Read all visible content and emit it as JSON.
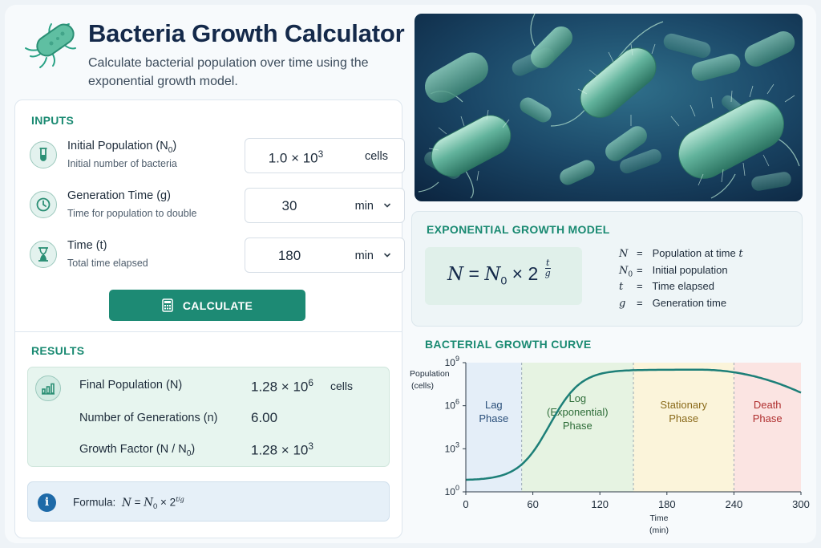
{
  "header": {
    "title": "Bacteria Growth Calculator",
    "subtitle": "Calculate bacterial population over time using the exponential growth model."
  },
  "inputs": {
    "section_title": "INPUTS",
    "initial_population": {
      "label_main": "Initial Population (N",
      "label_sub": "0",
      "label_end": ")",
      "description": "Initial number of bacteria",
      "value_mantissa": "1.0 × 10",
      "value_exp": "3",
      "unit": "cells",
      "icon": "test-tube-icon"
    },
    "generation_time": {
      "label": "Generation Time (g)",
      "description": "Time for population to double",
      "value": "30",
      "unit": "min",
      "icon": "clock-icon"
    },
    "time": {
      "label": "Time (t)",
      "description": "Total time elapsed",
      "value": "180",
      "unit": "min",
      "icon": "hourglass-icon"
    },
    "calculate_label": "CALCULATE"
  },
  "results": {
    "section_title": "RESULTS",
    "final_population": {
      "label": "Final Population (N)",
      "value_mantissa": "1.28 × 10",
      "value_exp": "6",
      "unit": "cells"
    },
    "generations": {
      "label": "Number of Generations (n)",
      "value": "6.00"
    },
    "growth_factor": {
      "label_main": "Growth Factor (N / N",
      "label_sub": "0",
      "label_end": ")",
      "value_mantissa": "1.28 × 10",
      "value_exp": "3"
    },
    "formula_label": "Formula:"
  },
  "model": {
    "section_title": "EXPONENTIAL GROWTH MODEL",
    "legend": [
      {
        "symbol": "N",
        "sub": "",
        "eq": "=",
        "text": "Population at time ",
        "var": "t"
      },
      {
        "symbol": "N",
        "sub": "0",
        "eq": "=",
        "text": "Initial population",
        "var": ""
      },
      {
        "symbol": "t",
        "sub": "",
        "eq": "=",
        "text": "Time elapsed",
        "var": ""
      },
      {
        "symbol": "g",
        "sub": "",
        "eq": "=",
        "text": "Generation time",
        "var": ""
      }
    ]
  },
  "curve": {
    "section_title": "BACTERIAL GROWTH CURVE",
    "ylabel_line1": "Population",
    "ylabel_line2": "(cells)",
    "xlabel_line1": "Time",
    "xlabel_line2": "(min)",
    "y_ticks": [
      {
        "base": "10",
        "exp": "0",
        "value": 0
      },
      {
        "base": "10",
        "exp": "3",
        "value": 3
      },
      {
        "base": "10",
        "exp": "6",
        "value": 6
      },
      {
        "base": "10",
        "exp": "9",
        "value": 9
      }
    ],
    "x_ticks": [
      "0",
      "60",
      "120",
      "180",
      "240",
      "300"
    ],
    "phases": [
      {
        "name_lines": [
          "Lag",
          "Phase"
        ],
        "start": 0,
        "end": 50,
        "fill": "#e4eef8",
        "text_color": "#2a4f7a"
      },
      {
        "name_lines": [
          "Log",
          "(Exponential)",
          "Phase"
        ],
        "start": 50,
        "end": 150,
        "fill": "#e6f3e2",
        "text_color": "#2f6e3a"
      },
      {
        "name_lines": [
          "Stationary",
          "Phase"
        ],
        "start": 150,
        "end": 240,
        "fill": "#fbf4da",
        "text_color": "#8a6a1a"
      },
      {
        "name_lines": [
          "Death",
          "Phase"
        ],
        "start": 240,
        "end": 300,
        "fill": "#fbe4e2",
        "text_color": "#b03030"
      }
    ],
    "curve_color": "#1d7f78"
  }
}
